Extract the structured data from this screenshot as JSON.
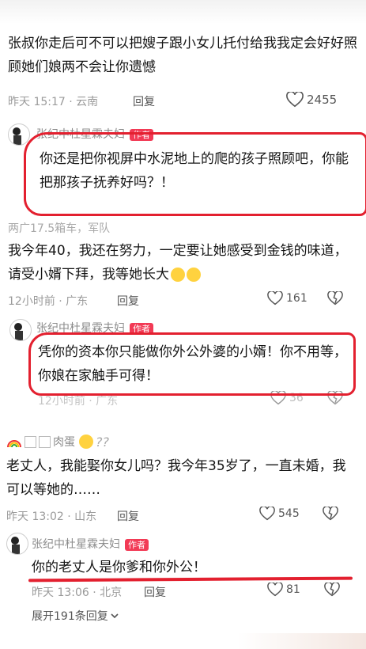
{
  "c1": {
    "text": "张叔你走后可不可以把嫂子跟小女儿托付给我我定会好好照顾她们娘两不会让你遗憾",
    "meta": "昨天 15:17 · 云南",
    "reply": "回复",
    "likes": "2455"
  },
  "r1": {
    "name": "张纪中杜星霖夫妇",
    "badge": "作者",
    "text": "你还是把你视屏中水泥地上的爬的孩子照顾吧，你能把那孩子抚养好吗？！"
  },
  "c2": {
    "name": "两广17.5箱车，军队",
    "text": "我今年40，我还在努力，一定要让她感受到金钱的味道，请受小婿下拜，我等她长大",
    "meta": "12小时前 · 广东",
    "reply": "回复",
    "likes": "161"
  },
  "r2": {
    "name": "张纪中杜星霖夫妇",
    "badge": "作者",
    "text": "凭你的资本你只能做你外公外婆的小婿！你不用等，你娘在家触手可得！",
    "meta": "12小时前 · 广东",
    "likes": "36"
  },
  "c3": {
    "name": "肉蛋",
    "text": "老丈人，我能娶你女儿吗？我今年35岁了，一直未婚，我可以等她的……",
    "meta": "昨天 13:02 · 山东",
    "reply": "回复",
    "likes": "545"
  },
  "r3": {
    "name": "张纪中杜星霖夫妇",
    "badge": "作者",
    "text": "你的老丈人是你爹和你外公！",
    "meta": "昨天 13:06 · 北京",
    "reply": "回复",
    "likes": "81"
  },
  "expand": "展开191条回复",
  "colors": {
    "annotation": "#e3202f",
    "author_badge": "#f23a55"
  },
  "icons": [
    "heart-icon",
    "dislike-heart-icon",
    "chevron-down-icon"
  ]
}
